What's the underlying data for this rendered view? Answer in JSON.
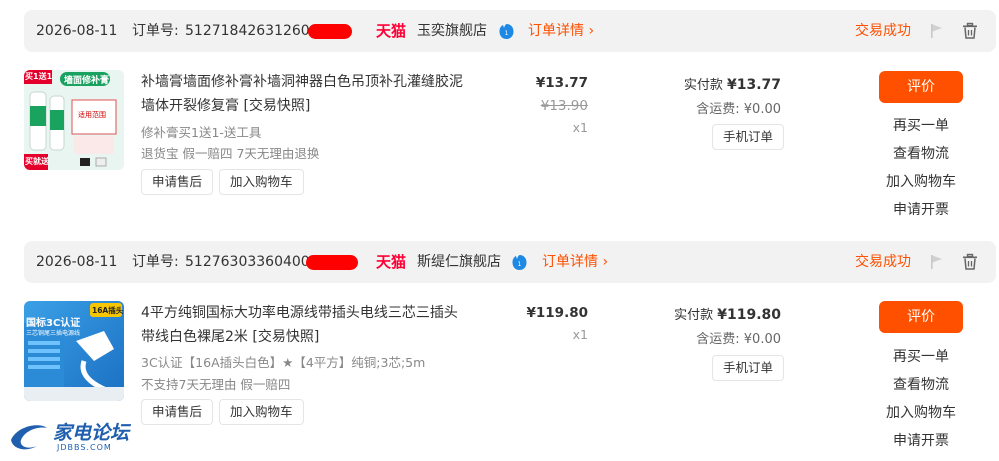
{
  "orders": [
    {
      "date": "2026-08-11",
      "order_label": "订单号:",
      "order_no": "51271842631260",
      "platform": "天猫",
      "shop": "玉奕旗舰店",
      "detail_link": "订单详情 ›",
      "status": "交易成功",
      "thumb_text": {
        "badge": "买1送1",
        "banner": "墙面修补膏",
        "side": "买就送",
        "sub": "适用范围"
      },
      "title": "补墙膏墙面修补膏补墙洞神器白色吊顶补孔灌缝胶泥墙体开裂修复膏 [交易快照]",
      "sku": "修补膏买1送1-送工具",
      "service": "退货宝  假一赔四  7天无理由退换",
      "btn_after_sale": "申请售后",
      "btn_add_cart": "加入购物车",
      "price": "¥13.77",
      "orig_price": "¥13.90",
      "qty": "x1",
      "paid_label": "实付款",
      "paid_amount": "¥13.77",
      "freight": "含运费: ¥0.00",
      "phone_order": "手机订单",
      "review": "评价",
      "ops": [
        "再买一单",
        "查看物流",
        "加入购物车",
        "申请开票"
      ]
    },
    {
      "date": "2026-08-11",
      "order_label": "订单号:",
      "order_no": "51276303360400",
      "platform": "天猫",
      "shop": "斯缇仁旗舰店",
      "detail_link": "订单详情 ›",
      "status": "交易成功",
      "thumb_text": {
        "badge": "16A插头",
        "banner": "国标3C认证",
        "sub": "三芯铜尾三插电源线"
      },
      "title": "4平方纯铜国标大功率电源线带插头电线三芯三插头带线白色裸尾2米 [交易快照]",
      "sku": "3C认证【16A插头白色】★【4平方】纯铜;3芯;5m",
      "service": "不支持7天无理由  假一赔四",
      "btn_after_sale": "申请售后",
      "btn_add_cart": "加入购物车",
      "price": "¥119.80",
      "qty": "x1",
      "paid_label": "实付款",
      "paid_amount": "¥119.80",
      "freight": "含运费: ¥0.00",
      "phone_order": "手机订单",
      "review": "评价",
      "ops": [
        "再买一单",
        "查看物流",
        "加入购物车",
        "申请开票"
      ]
    }
  ],
  "watermark": {
    "name": "家电论坛",
    "url": "JDBBS.COM"
  },
  "colors": {
    "accent": "#ff5000",
    "tmall": "#ff0036",
    "header_bg": "#f2f2f2"
  }
}
